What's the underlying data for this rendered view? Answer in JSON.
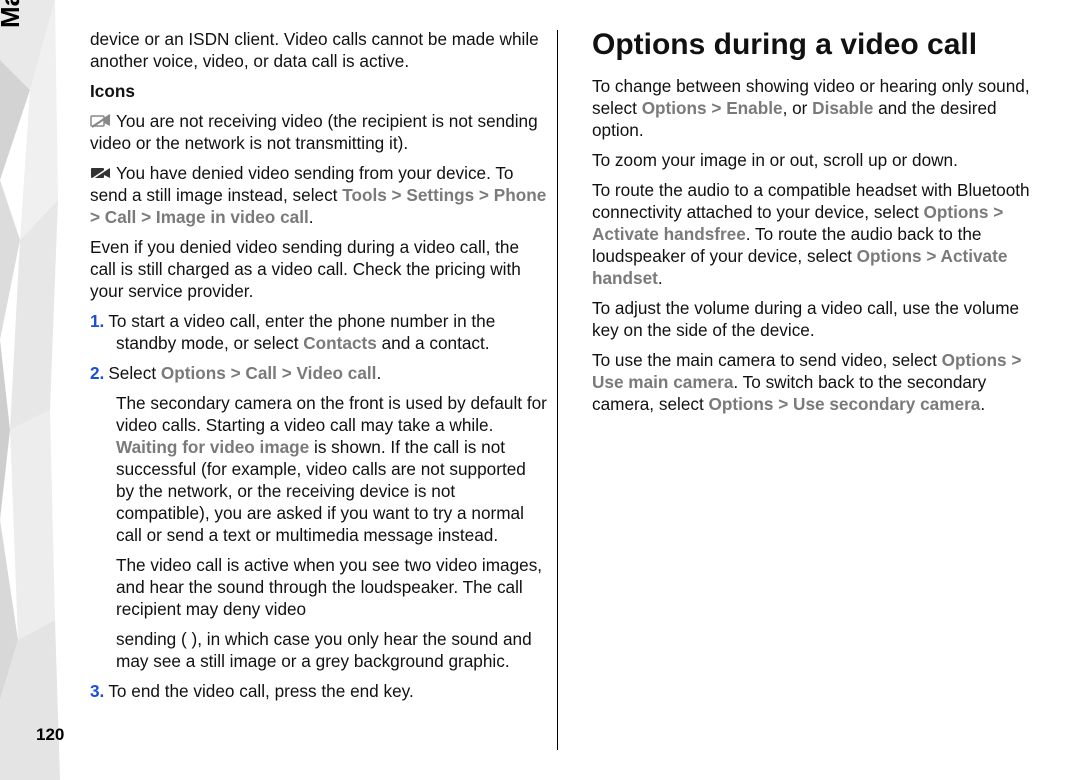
{
  "sidebar": {
    "label": "Make calls"
  },
  "page_number": "120",
  "left": {
    "intro": "device or an ISDN client. Video calls cannot be made while another voice, video, or data call is active.",
    "icons_heading": "Icons",
    "icon_desc_1": "You are not receiving video (the recipient is not sending video or the network is not transmitting it).",
    "icon_desc_2_pre": "You have denied video sending from your device. To send a still image instead, select ",
    "icon_desc_2_menu": "Tools  >  Settings  >  Phone  >  Call  >  Image in video call",
    "icon_desc_2_post": ".",
    "charged": "Even if you denied video sending during a video call, the call is still charged as a video call. Check the pricing with your service provider.",
    "step1_pre": "To start a video call, enter the phone number in the standby mode, or select ",
    "step1_menu": "Contacts",
    "step1_post": " and a contact.",
    "step2_pre": "Select ",
    "step2_menu": "Options  >  Call  >  Video call",
    "step2_post": ".",
    "step2_follow_a_pre": "The secondary camera on the front is used by default for video calls. Starting a video call may take a while. ",
    "step2_follow_a_menu": "Waiting for video image",
    "step2_follow_a_post": " is shown. If the call is not successful (for example, video calls are not supported by the network, or the receiving device is not compatible), you are asked if you want to try a normal call or send a text or multimedia message instead.",
    "step2_follow_b": "The video call is active when you see two video images, and hear the sound through the loudspeaker. The call recipient may deny video"
  },
  "right": {
    "sending_cont": "sending (      ), in which case you only hear the sound and may see a still image or a grey background graphic.",
    "step3": "To end the video call, press the end key.",
    "h2": "Options during a video call",
    "p1_pre": "To change between showing video or hearing only sound, select ",
    "p1_menu1": "Options  >  Enable",
    "p1_mid": ", or ",
    "p1_menu2": "Disable",
    "p1_post": " and the desired option.",
    "p2": "To zoom your image in or out, scroll up or down.",
    "p3_pre": "To route the audio to a compatible headset with Bluetooth connectivity attached to your device, select ",
    "p3_menu1": "Options  >  Activate handsfree",
    "p3_mid": ". To route the audio back to the loudspeaker of your device, select ",
    "p3_menu2": "Options  >  Activate handset",
    "p3_post": ".",
    "p4": "To adjust the volume during a video call, use the volume key on the side of the device.",
    "p5_pre": "To use the main camera to send video, select ",
    "p5_menu1": "Options  >  Use main camera",
    "p5_mid": ". To switch back to the secondary camera, select ",
    "p5_menu2": "Options  >  Use secondary camera",
    "p5_post": "."
  },
  "nums": {
    "one": "1.",
    "two": "2.",
    "three": "3."
  }
}
